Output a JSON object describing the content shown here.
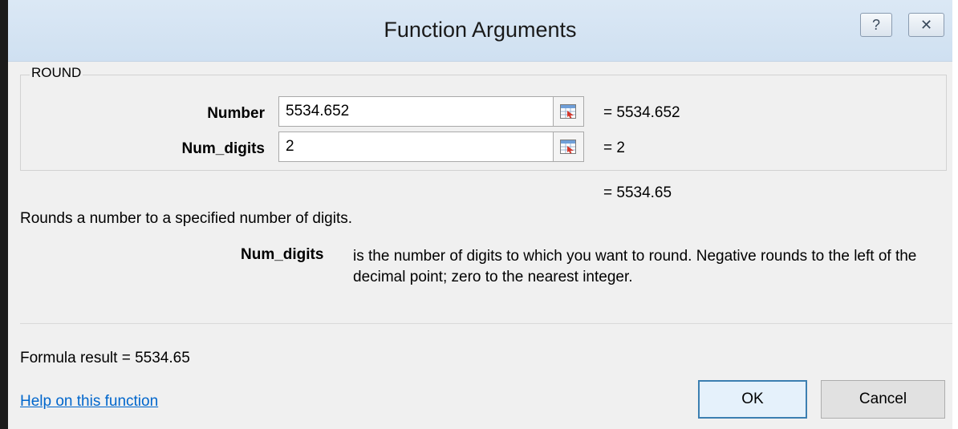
{
  "dialog": {
    "title": "Function Arguments",
    "help_button": "?",
    "close_button": "✕"
  },
  "function": {
    "name": "ROUND",
    "arguments": [
      {
        "label": "Number",
        "value": "5534.652",
        "evaluated": "=  5534.652"
      },
      {
        "label": "Num_digits",
        "value": "2",
        "evaluated": "=  2"
      }
    ],
    "result_preview": "=  5534.65",
    "description": "Rounds a number to a specified number of digits.",
    "arg_help": {
      "name": "Num_digits",
      "text": "is the number of digits to which you want to round. Negative rounds to the left of the decimal point; zero to the nearest integer."
    }
  },
  "footer": {
    "formula_result": "Formula result =   5534.65",
    "help_link": "Help on this function",
    "ok_label": "OK",
    "cancel_label": "Cancel"
  }
}
